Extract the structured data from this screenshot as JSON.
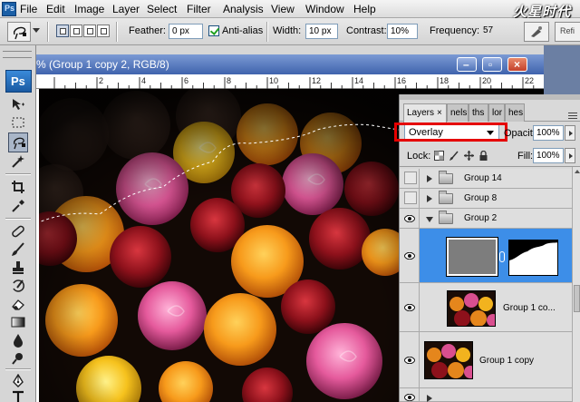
{
  "menu": [
    "File",
    "Edit",
    "Image",
    "Layer",
    "Select",
    "Filter",
    "Analysis",
    "View",
    "Window",
    "Help"
  ],
  "watermark": "火星时代",
  "options": {
    "feather_label": "Feather:",
    "feather_value": "0 px",
    "antialias_label": "Anti-alias",
    "antialias_checked": true,
    "width_label": "Width:",
    "width_value": "10 px",
    "contrast_label": "Contrast:",
    "contrast_value": "10%",
    "frequency_label": "Frequency:",
    "frequency_value": "57",
    "refine_label": "Refi"
  },
  "tools": {
    "logo": "Ps",
    "icons": [
      "move-icon",
      "marquee-icon",
      "magnetic-lasso-icon",
      "magic-wand-icon",
      "crop-icon",
      "eyedropper-icon",
      "healing-brush-icon",
      "brush-icon",
      "clone-stamp-icon",
      "history-brush-icon",
      "eraser-icon",
      "gradient-icon",
      "blur-icon",
      "dodge-icon",
      "pen-icon",
      "type-icon"
    ],
    "active": "magnetic-lasso-icon"
  },
  "document": {
    "title": "% (Group 1 copy 2, RGB/8)",
    "ruler_ticks": [
      "2",
      "4",
      "6",
      "8",
      "10",
      "12",
      "14",
      "16",
      "18",
      "20",
      "22"
    ]
  },
  "layers_panel": {
    "tabs": [
      {
        "label": "Layers",
        "close": "×"
      },
      {
        "label": "nels"
      },
      {
        "label": "ths"
      },
      {
        "label": "lor"
      },
      {
        "label": "hes"
      }
    ],
    "blend_mode": "Overlay",
    "opacity_label": "Opacity:",
    "opacity_value": "100%",
    "lock_label": "Lock:",
    "fill_label": "Fill:",
    "fill_value": "100%",
    "layers": [
      {
        "name": "Group 14",
        "type": "group",
        "visible": false,
        "expanded": false
      },
      {
        "name": "Group 8",
        "type": "group",
        "visible": false,
        "expanded": false
      },
      {
        "name": "Group 2",
        "type": "group",
        "visible": true,
        "expanded": true
      },
      {
        "name": "",
        "type": "masked-layer",
        "visible": true,
        "selected": true
      },
      {
        "name": "Group 1 co...",
        "type": "layer",
        "visible": true
      },
      {
        "name": "Group 1 copy",
        "type": "layer",
        "visible": true
      }
    ]
  },
  "colors": {
    "accent_selected": "#3d8ee8",
    "highlight_box": "#e50000",
    "title_bar": "#4f73b8"
  }
}
